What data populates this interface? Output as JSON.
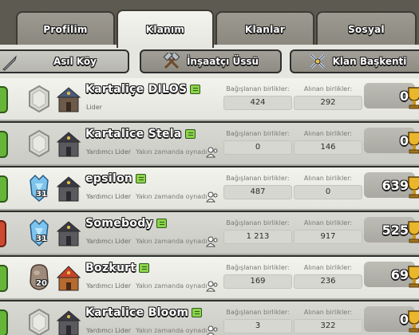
{
  "tabs": [
    {
      "label": "Profilim"
    },
    {
      "label": "Klanım"
    },
    {
      "label": "Klanlar"
    },
    {
      "label": "Sosyal"
    }
  ],
  "subtabs": [
    {
      "label": "Asıl Köy",
      "icon": "sword-icon"
    },
    {
      "label": "İnşaatçı Üssü",
      "icon": "crossed-hammers-icon"
    },
    {
      "label": "Klan Başkenti",
      "icon": "crossed-swords-icon"
    }
  ],
  "stat_labels": {
    "donated": "Bağışlanan birlikler:",
    "received": "Alınan birlikler:"
  },
  "members": [
    {
      "name": "Kartaliçe DILOS",
      "role": "Lider",
      "recent": "",
      "donated": "424",
      "received": "292",
      "trophies": "0",
      "league_level": "",
      "league": "unranked"
    },
    {
      "name": "Kartalice Stela",
      "role": "Yardımcı Lider",
      "recent": "Yakın zamanda oynadı",
      "donated": "0",
      "received": "146",
      "trophies": "0",
      "league_level": "",
      "league": "unranked"
    },
    {
      "name": "epsilon",
      "role": "Yardımcı Lider",
      "recent": "Yakın zamanda oynadı",
      "donated": "487",
      "received": "0",
      "trophies": "639",
      "league_level": "31",
      "league": "crystal"
    },
    {
      "name": "Somebody",
      "role": "Yardımcı Lider",
      "recent": "Yakın zamanda oynadı",
      "donated": "1 213",
      "received": "917",
      "trophies": "525",
      "league_level": "31",
      "league": "crystal"
    },
    {
      "name": "Bozkurt",
      "role": "Yardımcı Lider",
      "recent": "Yakın zamanda oynadı",
      "donated": "169",
      "received": "236",
      "trophies": "69",
      "league_level": "20",
      "league": "stone"
    },
    {
      "name": "Kartalice Bloom",
      "role": "Yardımcı Lider",
      "recent": "Yakın zamanda oynadı",
      "donated": "3",
      "received": "322",
      "trophies": "0",
      "league_level": "",
      "league": "unranked"
    }
  ],
  "colors": {
    "green_accent": "#66b438",
    "red_accent": "#cc4a30",
    "active_tab": "#f4f4ef"
  }
}
